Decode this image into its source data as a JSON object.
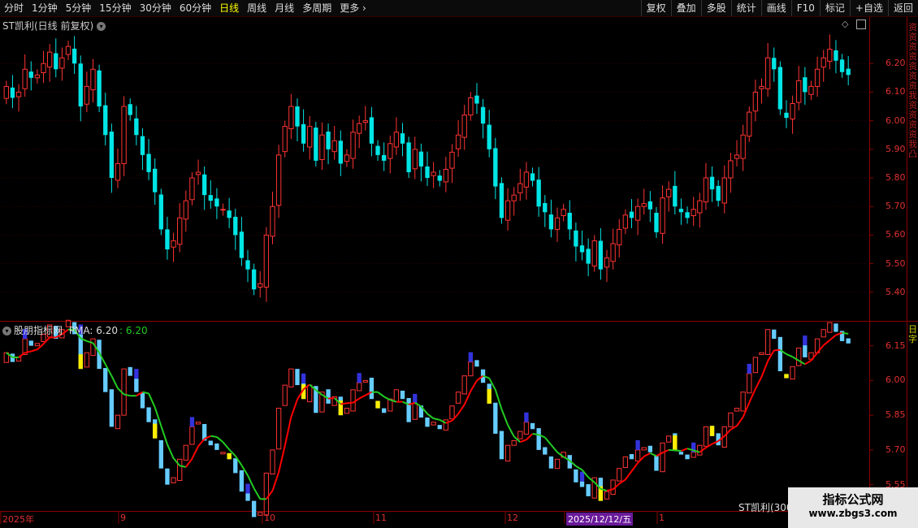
{
  "toolbar": {
    "periods": [
      "分时",
      "1分钟",
      "5分钟",
      "15分钟",
      "30分钟",
      "60分钟",
      "日线",
      "周线",
      "月线",
      "多周期",
      "更多"
    ],
    "active_period": "日线",
    "right_buttons": [
      "复权",
      "叠加",
      "多股",
      "统计",
      "画线",
      "F10",
      "标记",
      "+自选",
      "返回"
    ]
  },
  "main_chart": {
    "title": "ST凯利(日线 前复权)",
    "price_ticks": [
      "6.20",
      "6.10",
      "6.00",
      "5.90",
      "5.80",
      "5.70",
      "5.60",
      "5.50",
      "5.40"
    ],
    "side_chars": "资资资资资资资我资资资资我凸"
  },
  "indicator": {
    "name": "股朋指标网",
    "pma_label": "PMA: 6.20",
    "pma_value": ": 6.20",
    "ticks": [
      "6.15",
      "6.00",
      "5.85",
      "5.70",
      "5.55"
    ],
    "stock_tag": "ST凯利(300",
    "side_chars": "日字"
  },
  "date_axis": {
    "labels": [
      "2025年",
      "9",
      "10",
      "11",
      "12",
      "2025/12/12/五",
      "1"
    ]
  },
  "watermark": {
    "line1": "指标公式网",
    "line2": "www.zbgs3.com"
  },
  "colors": {
    "up": "#ff3333",
    "down": "#00e5e5",
    "ma_up": "#ff0000",
    "ma_down": "#22cc22",
    "grid": "#8b0000"
  },
  "chart_data": {
    "type": "candlestick",
    "ylim": [
      5.3,
      6.32
    ],
    "closes": [
      6.12,
      6.08,
      6.1,
      6.18,
      6.15,
      6.16,
      6.2,
      6.24,
      6.18,
      6.22,
      6.26,
      6.2,
      6.05,
      6.12,
      6.18,
      6.05,
      5.95,
      5.8,
      5.85,
      6.05,
      6.02,
      5.95,
      5.88,
      5.82,
      5.75,
      5.62,
      5.55,
      5.58,
      5.66,
      5.72,
      5.8,
      5.82,
      5.74,
      5.72,
      5.7,
      5.69,
      5.66,
      5.6,
      5.52,
      5.48,
      5.41,
      5.43,
      5.6,
      5.7,
      5.88,
      5.98,
      6.05,
      5.98,
      5.92,
      5.98,
      5.86,
      5.95,
      5.9,
      5.93,
      5.85,
      5.88,
      5.96,
      5.99,
      6.0,
      5.92,
      5.88,
      5.86,
      5.92,
      5.96,
      5.92,
      5.82,
      5.9,
      5.84,
      5.8,
      5.82,
      5.79,
      5.83,
      5.89,
      5.95,
      6.02,
      6.08,
      6.06,
      5.99,
      5.9,
      5.77,
      5.66,
      5.72,
      5.74,
      5.78,
      5.82,
      5.79,
      5.7,
      5.68,
      5.62,
      5.66,
      5.69,
      5.62,
      5.56,
      5.54,
      5.5,
      5.58,
      5.48,
      5.52,
      5.57,
      5.62,
      5.67,
      5.66,
      5.7,
      5.71,
      5.69,
      5.61,
      5.73,
      5.76,
      5.7,
      5.68,
      5.66,
      5.69,
      5.72,
      5.8,
      5.76,
      5.72,
      5.8,
      5.86,
      5.88,
      5.95,
      6.03,
      6.1,
      6.12,
      6.22,
      6.18,
      6.04,
      6.01,
      6.06,
      6.14,
      6.1,
      6.12,
      6.18,
      6.22,
      6.25,
      6.21,
      6.17,
      6.16
    ]
  }
}
